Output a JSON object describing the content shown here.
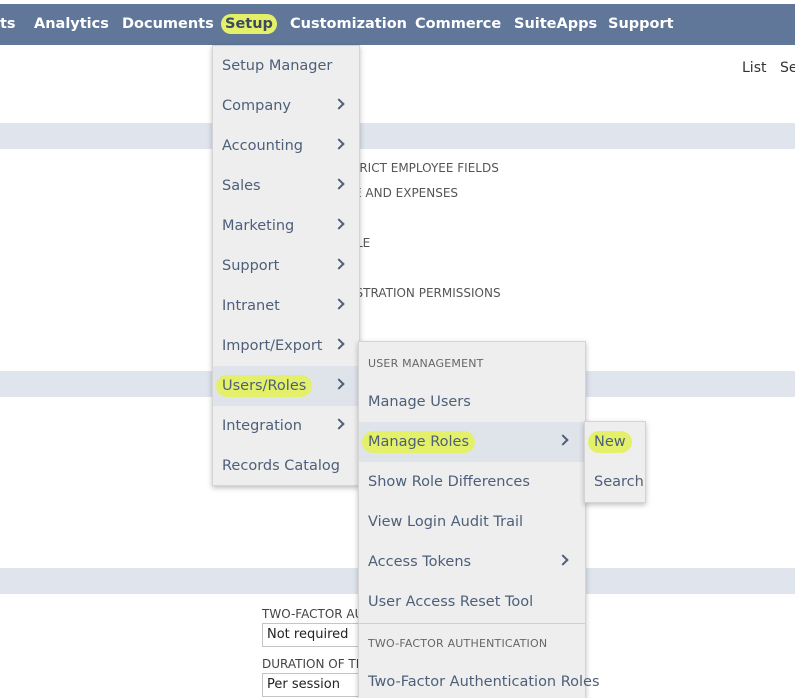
{
  "nav": {
    "items": [
      {
        "label": "ts"
      },
      {
        "label": "Analytics"
      },
      {
        "label": "Documents"
      },
      {
        "label": "Setup"
      },
      {
        "label": "Customization"
      },
      {
        "label": "Commerce"
      },
      {
        "label": "SuiteApps"
      },
      {
        "label": "Support"
      }
    ]
  },
  "page": {
    "list_link": "List",
    "search_link": "Se",
    "bg_texts": [
      "TRICT EMPLOYEE FIELDS",
      "E AND EXPENSES",
      "LE",
      "ISTRATION PERMISSIONS"
    ],
    "fields": {
      "two_factor_label": "TWO-FACTOR AUT",
      "two_factor_value": "Not required",
      "duration_label": "DURATION OF TR",
      "duration_value": "Per session"
    }
  },
  "setup_menu": {
    "items": [
      {
        "label": "Setup Manager"
      },
      {
        "label": "Company"
      },
      {
        "label": "Accounting"
      },
      {
        "label": "Sales"
      },
      {
        "label": "Marketing"
      },
      {
        "label": "Support"
      },
      {
        "label": "Intranet"
      },
      {
        "label": "Import/Export"
      },
      {
        "label": "Users/Roles"
      },
      {
        "label": "Integration"
      },
      {
        "label": "Records Catalog"
      }
    ]
  },
  "users_roles_menu": {
    "header_user_management": "USER MANAGEMENT",
    "items": [
      {
        "label": "Manage Users"
      },
      {
        "label": "Manage Roles"
      },
      {
        "label": "Show Role Differences"
      },
      {
        "label": "View Login Audit Trail"
      },
      {
        "label": "Access Tokens"
      },
      {
        "label": "User Access Reset Tool"
      }
    ],
    "header_two_factor": "TWO-FACTOR AUTHENTICATION",
    "two_factor_item": "Two-Factor Authentication Roles"
  },
  "manage_roles_menu": {
    "items": [
      {
        "label": "New"
      },
      {
        "label": "Search"
      }
    ]
  },
  "colors": {
    "nav_bg": "#607799",
    "highlight": "#e4f06a",
    "band": "#dfe4ed",
    "menu_bg": "#eeeeee",
    "menu_text": "#4d5f79"
  }
}
